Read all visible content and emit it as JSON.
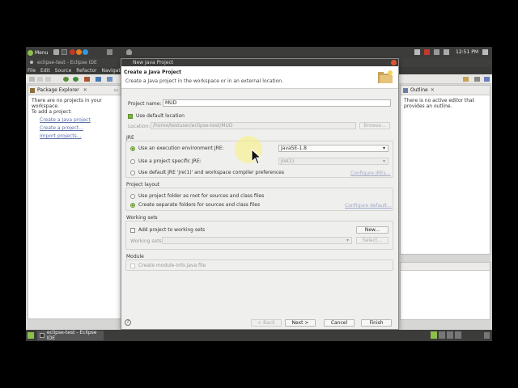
{
  "panel": {
    "menu_label": "Menu",
    "clock": "12:51 PM"
  },
  "ide": {
    "title": "eclipse-test - Eclipse IDE",
    "menus": [
      "File",
      "Edit",
      "Source",
      "Refactor",
      "Navigate"
    ],
    "package_explorer": {
      "tab_label": "Package Explorer",
      "message_line1": "There are no projects in your workspace.",
      "message_line2": "To add a project:",
      "links": [
        "Create a Java project",
        "Create a project...",
        "Import projects..."
      ]
    },
    "outline": {
      "tab_label": "Outline",
      "message": "There is no active editor that provides an outline."
    }
  },
  "dialog": {
    "window_title": "New Java Project",
    "header_title": "Create a Java Project",
    "header_desc": "Create a Java project in the workspace or in an external location.",
    "project_name_label": "Project name:",
    "project_name_value": "MUD",
    "use_default_location_label": "Use default location",
    "location_label": "Location:",
    "location_value": "/home/testuser/eclipse-test/MUD",
    "browse_label": "Browse...",
    "jre": {
      "group_title": "JRE",
      "option_exec_env": "Use an execution environment JRE:",
      "exec_env_value": "JavaSE-1.8",
      "option_specific": "Use a project specific JRE:",
      "specific_value": "jre(1)",
      "option_default": "Use default JRE 'jre(1)' and workspace compiler preferences",
      "configure_link": "Configure JREs..."
    },
    "layout": {
      "group_title": "Project layout",
      "option_root": "Use project folder as root for sources and class files",
      "option_separate": "Create separate folders for sources and class files",
      "configure_link": "Configure default..."
    },
    "working_sets": {
      "group_title": "Working sets",
      "add_label": "Add project to working sets",
      "new_label": "New...",
      "sets_label": "Working sets:",
      "select_label": "Select..."
    },
    "module": {
      "group_title": "Module",
      "create_label": "Create module-info.java file"
    },
    "buttons": {
      "back": "< Back",
      "next": "Next >",
      "cancel": "Cancel",
      "finish": "Finish"
    }
  },
  "taskbar": {
    "task_label": "eclipse-test - Eclipse IDE"
  },
  "colors": {
    "accent_green": "#6a9a2a",
    "panel_bg": "#3c3c3b",
    "link_blue": "#5a6fa8"
  }
}
